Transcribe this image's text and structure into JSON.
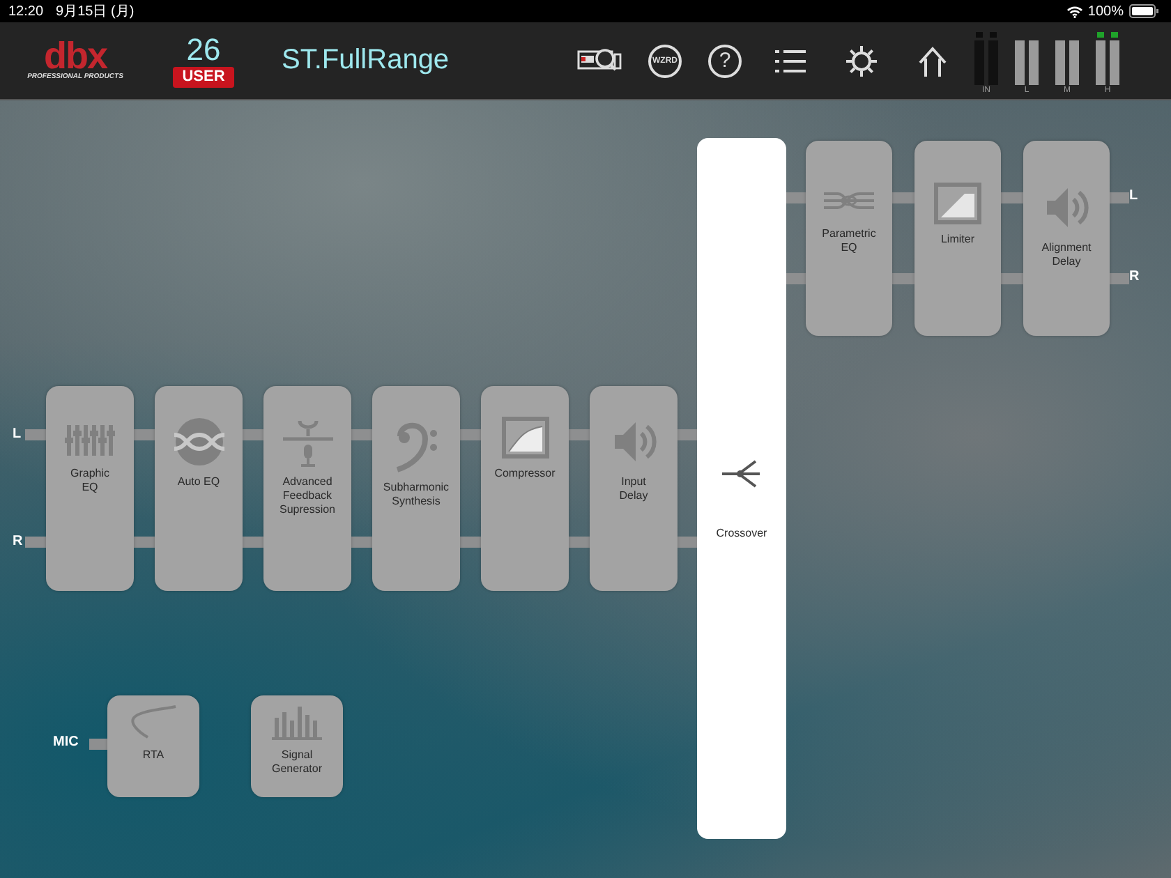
{
  "status_bar": {
    "time": "12:20",
    "date": "9月15日 (月)",
    "battery": "100%"
  },
  "header": {
    "logo": "dbx",
    "logo_tagline": "PROFESSIONAL PRODUCTS",
    "preset_number": "26",
    "preset_badge": "USER",
    "preset_name": "ST.FullRange",
    "toolbar": [
      {
        "kind": "inspect"
      },
      {
        "kind": "wizard",
        "label": "WZRD"
      },
      {
        "kind": "help",
        "label": "?"
      },
      {
        "kind": "list"
      },
      {
        "kind": "settings"
      },
      {
        "kind": "home"
      }
    ],
    "meters": [
      {
        "label": "IN",
        "kind": "input",
        "lit": false
      },
      {
        "label": "L",
        "kind": "output",
        "lit": false
      },
      {
        "label": "M",
        "kind": "output",
        "lit": false
      },
      {
        "label": "H",
        "kind": "output",
        "lit": true
      }
    ]
  },
  "input_labels": [
    "L",
    "R"
  ],
  "input_chain": [
    {
      "label": "Graphic\nEQ"
    },
    {
      "label": "Auto EQ"
    },
    {
      "label": "Advanced\nFeedback\nSupression"
    },
    {
      "label": "Subharmonic\nSynthesis"
    },
    {
      "label": "Compressor"
    },
    {
      "label": "Input\nDelay"
    }
  ],
  "crossover": {
    "label": "Crossover"
  },
  "output_chain": [
    {
      "label": "Parametric\nEQ"
    },
    {
      "label": "Limiter"
    },
    {
      "label": "Alignment\nDelay"
    }
  ],
  "output_labels": [
    "L",
    "R"
  ],
  "mic_label": "MIC",
  "tools": [
    {
      "label": "RTA"
    },
    {
      "label": "Signal\nGenerator"
    }
  ]
}
